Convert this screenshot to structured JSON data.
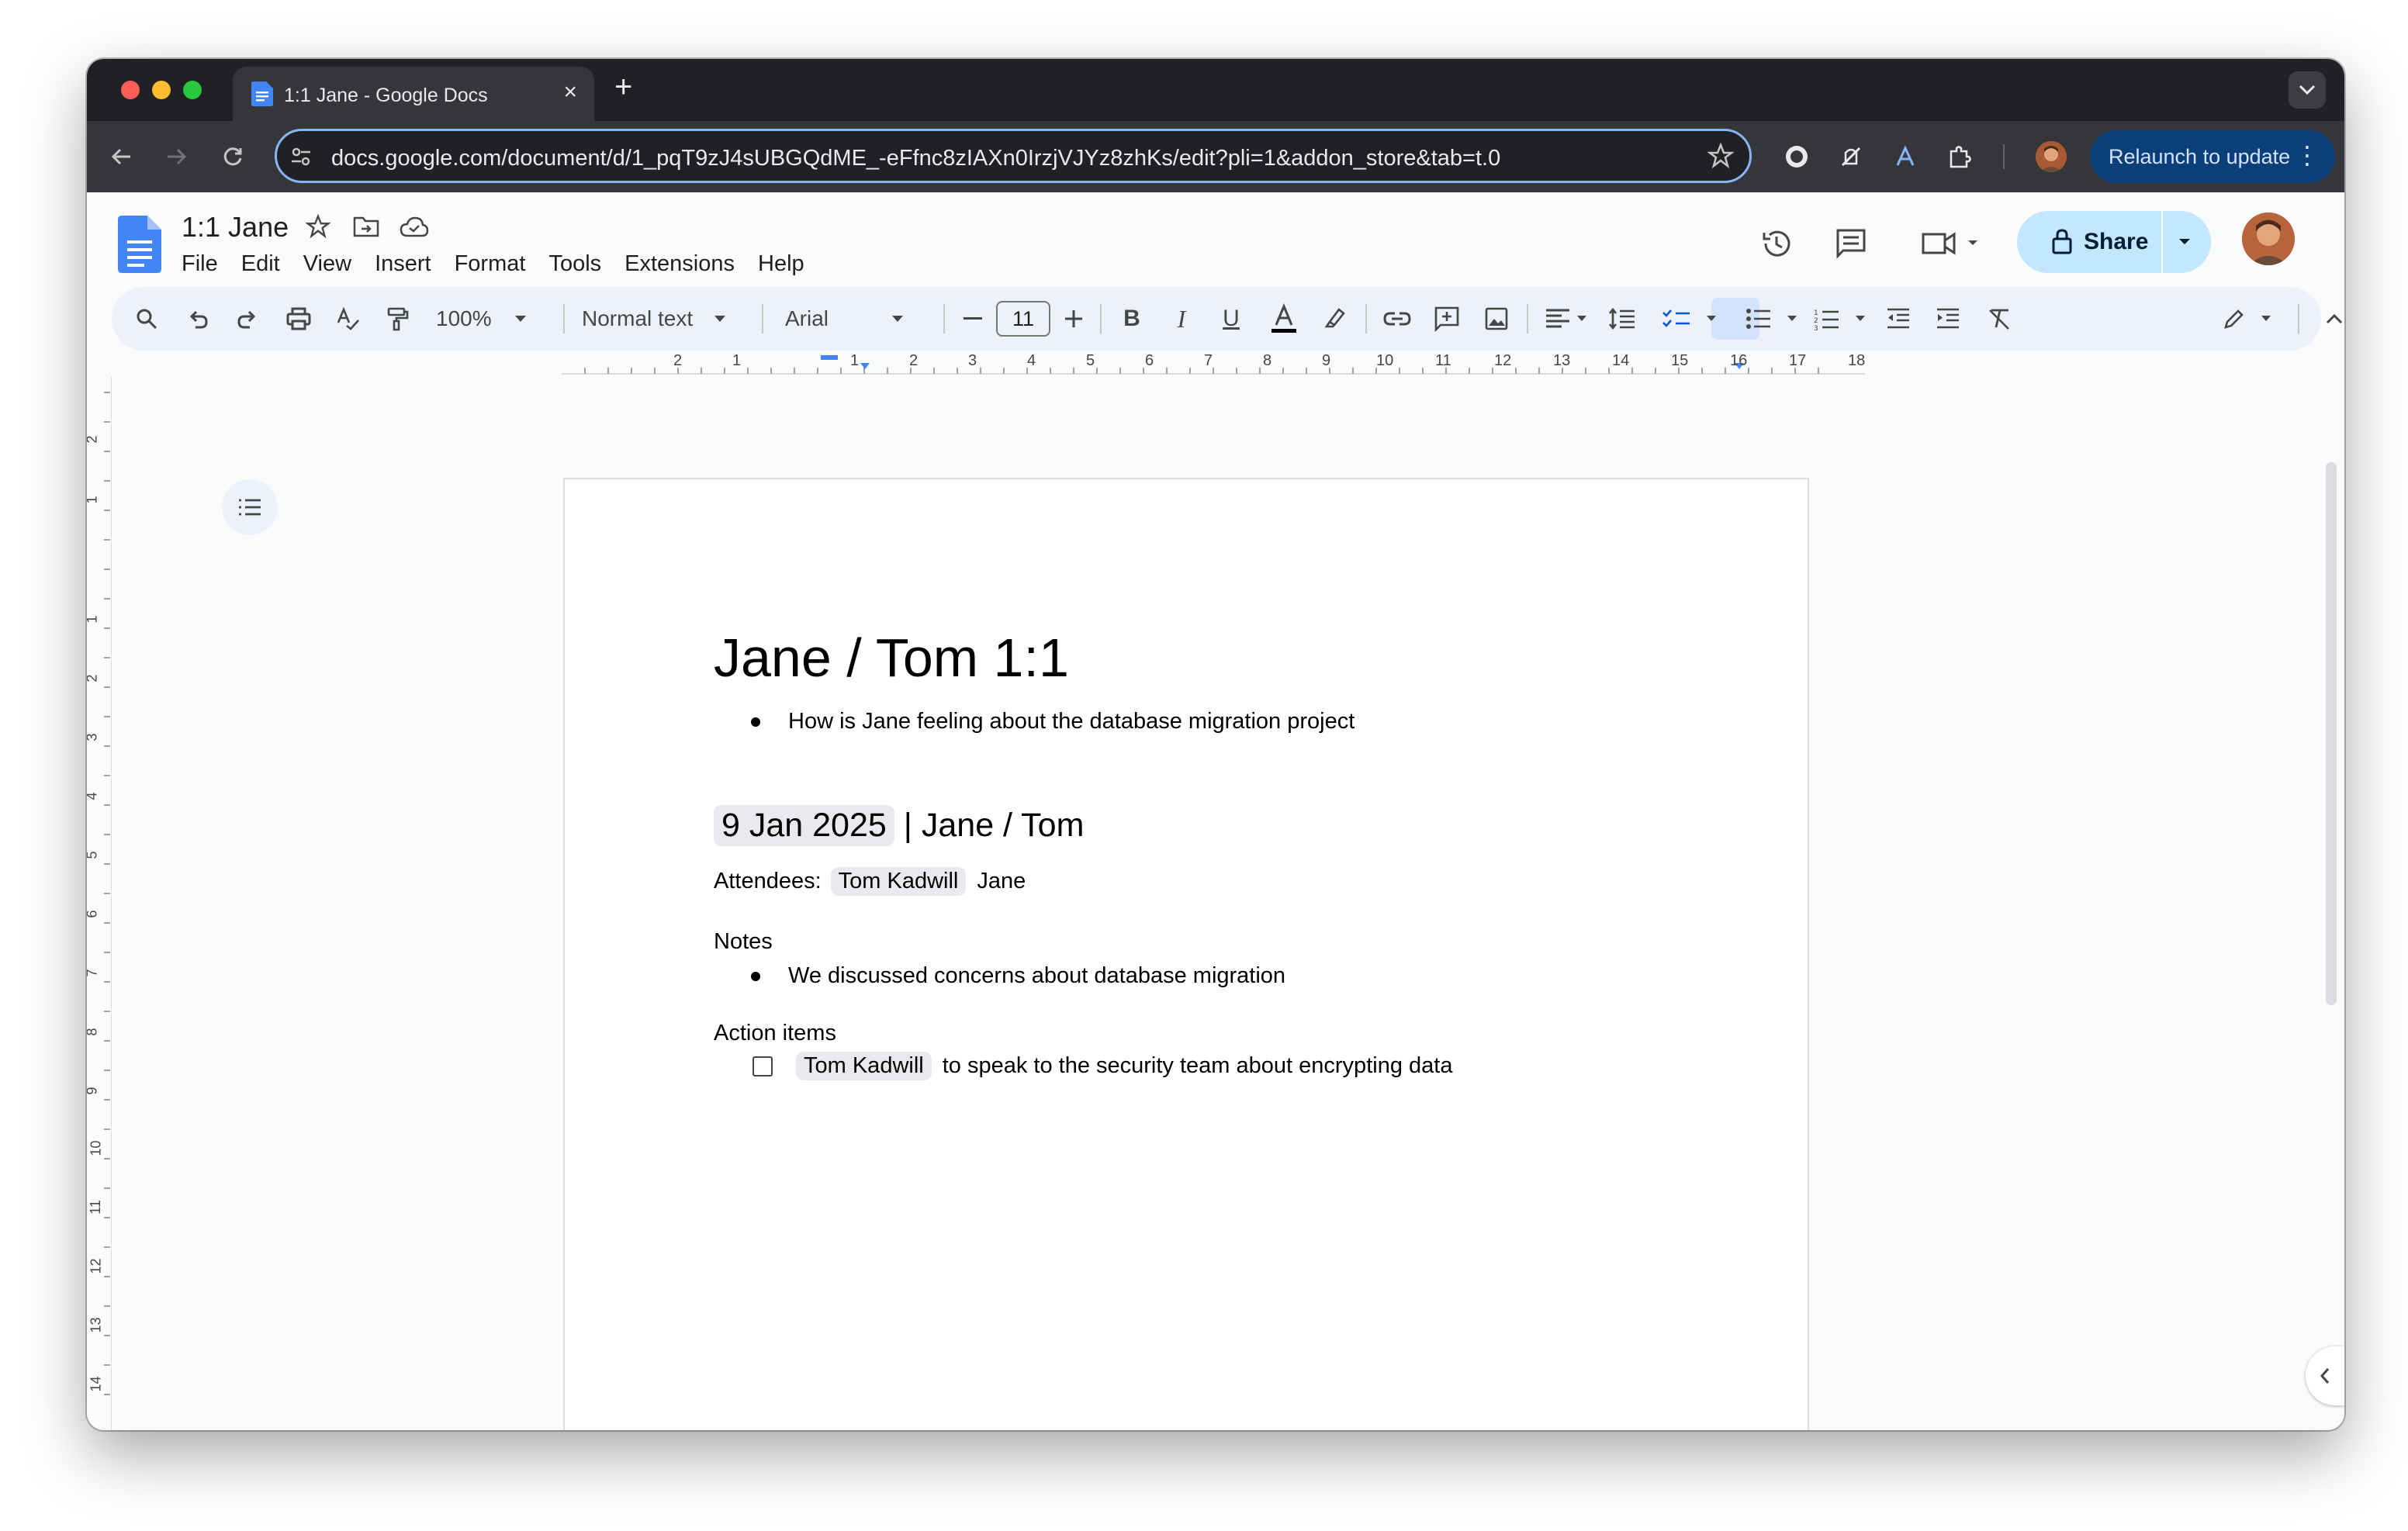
{
  "browser": {
    "tab_title": "1:1 Jane - Google Docs",
    "url": "docs.google.com/document/d/1_pqT9zJ4sUBGQdME_-eFfnc8zIAXn0IrzjVJYz8zhKs/edit?pli=1&addon_store&tab=t.0",
    "relaunch_label": "Relaunch to update"
  },
  "docs": {
    "title": "1:1 Jane",
    "menu": [
      "File",
      "Edit",
      "View",
      "Insert",
      "Format",
      "Tools",
      "Extensions",
      "Help"
    ],
    "share_label": "Share",
    "toolbar": {
      "zoom": "100%",
      "style": "Normal text",
      "font": "Arial",
      "font_size": "11"
    },
    "ruler_numbers": [
      "2",
      "1",
      "1",
      "2",
      "3",
      "4",
      "5",
      "6",
      "7",
      "8",
      "9",
      "10",
      "11",
      "12",
      "13",
      "14",
      "15",
      "16",
      "17",
      "18"
    ],
    "vruler_numbers": [
      "2",
      "1",
      "1",
      "2",
      "3",
      "4",
      "5",
      "6",
      "7",
      "8",
      "9",
      "10",
      "11",
      "12",
      "13",
      "14"
    ]
  },
  "document": {
    "heading": "Jane / Tom 1:1",
    "intro_bullet": "How is Jane feeling about the database migration project",
    "meeting_date": "9 Jan 2025",
    "meeting_rest": " | Jane / Tom",
    "attendees_label": "Attendees:",
    "attendee_chip": "Tom Kadwill",
    "attendee_other": "Jane",
    "notes_label": "Notes",
    "notes_bullet": "We discussed concerns about database migration",
    "action_label": "Action items",
    "action_chip": "Tom Kadwill",
    "action_text": "to speak to the security team about encrypting data"
  },
  "colors": {
    "share_bg": "#c2e7ff",
    "docs_blue": "#4285f4",
    "relaunch_bg": "#0b3f7a"
  },
  "icons": [
    "search-icon",
    "undo-icon",
    "redo-icon",
    "print-icon",
    "spellcheck-icon",
    "paint-format-icon",
    "bold-icon",
    "italic-icon",
    "underline-icon",
    "text-color-icon",
    "highlight-icon",
    "link-icon",
    "comment-icon",
    "image-icon",
    "align-icon",
    "line-spacing-icon",
    "checklist-icon",
    "bullet-list-icon",
    "numbered-list-icon",
    "indent-decrease-icon",
    "indent-increase-icon",
    "clear-format-icon",
    "pencil-icon",
    "history-icon",
    "comments-icon",
    "meet-icon"
  ]
}
